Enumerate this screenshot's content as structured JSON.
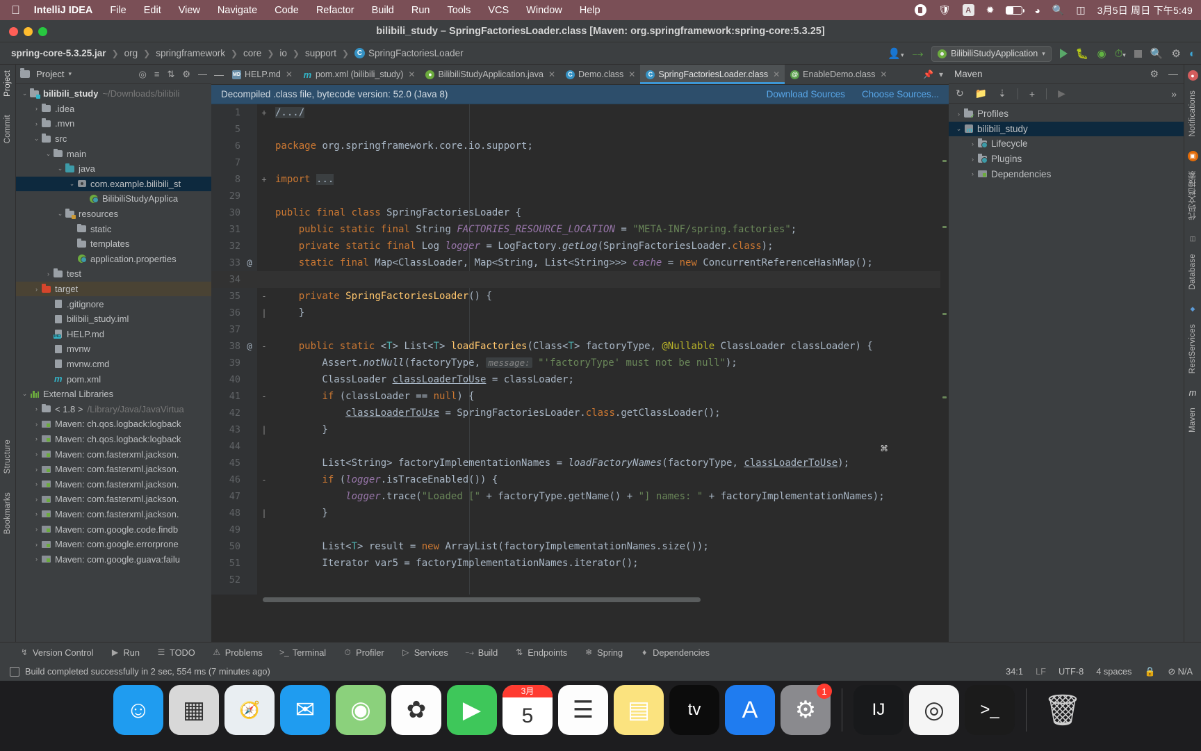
{
  "macos": {
    "apple_icon": "apple-icon",
    "app_name": "IntelliJ IDEA",
    "menus": [
      "File",
      "Edit",
      "View",
      "Navigate",
      "Code",
      "Refactor",
      "Build",
      "Run",
      "Tools",
      "VCS",
      "Window",
      "Help"
    ],
    "status_icons": [
      "record-icon",
      "shield-icon",
      "input-source-icon",
      "bluetooth-icon",
      "battery-icon",
      "wifi-icon",
      "search-icon",
      "control-center-icon"
    ],
    "input_source_label": "A",
    "clock": "3月5日 周日 下午5:49"
  },
  "window": {
    "title": "bilibili_study – SpringFactoriesLoader.class [Maven: org.springframework:spring-core:5.3.25]"
  },
  "breadcrumb": {
    "items": [
      "spring-core-5.3.25.jar",
      "org",
      "springframework",
      "core",
      "io",
      "support"
    ],
    "class_name": "SpringFactoriesLoader",
    "class_icon": "class-icon"
  },
  "toolbar": {
    "profile_icon": "user-profile-icon",
    "build_icon": "hammer-icon",
    "run_config": "BilibiliStudyApplication",
    "run_icon": "run-icon",
    "debug_icon": "debug-icon",
    "coverage_icon": "run-with-coverage-icon",
    "profiler_icon": "profiler-icon",
    "stop_icon": "stop-icon",
    "search_icon": "search-everywhere-icon",
    "settings_icon": "gear-icon",
    "updates_icon": "updates-icon"
  },
  "left_strip": {
    "items": [
      "Project",
      "Commit",
      "Structure",
      "Bookmarks"
    ]
  },
  "right_strip": {
    "items": [
      "Notifications",
      "代码文档搜索",
      "Database",
      "RestServices",
      "Maven"
    ]
  },
  "project_panel": {
    "title": "Project",
    "header_icons": [
      "locate-icon",
      "collapse-all-icon",
      "sort-icon",
      "settings-icon",
      "hide-icon"
    ],
    "tree": [
      {
        "indent": 0,
        "arrow": "v",
        "icon": "module-folder-icon",
        "label": "bilibili_study",
        "sub": "~/Downloads/bilibili",
        "bold": true,
        "state": "normal"
      },
      {
        "indent": 1,
        "arrow": ">",
        "icon": "folder-icon",
        "label": ".idea",
        "sub": "",
        "bold": false,
        "state": "normal"
      },
      {
        "indent": 1,
        "arrow": ">",
        "icon": "folder-icon",
        "label": ".mvn",
        "sub": "",
        "bold": false,
        "state": "normal"
      },
      {
        "indent": 1,
        "arrow": "v",
        "icon": "folder-icon",
        "label": "src",
        "sub": "",
        "bold": false,
        "state": "normal"
      },
      {
        "indent": 2,
        "arrow": "v",
        "icon": "folder-icon",
        "label": "main",
        "sub": "",
        "bold": false,
        "state": "normal"
      },
      {
        "indent": 3,
        "arrow": "v",
        "icon": "source-folder-icon",
        "label": "java",
        "sub": "",
        "bold": false,
        "state": "normal"
      },
      {
        "indent": 4,
        "arrow": "v",
        "icon": "package-icon",
        "label": "com.example.bilibili_st",
        "sub": "",
        "bold": false,
        "state": "selected"
      },
      {
        "indent": 5,
        "arrow": "",
        "icon": "spring-class-icon",
        "label": "BilibiliStudyApplica",
        "sub": "",
        "bold": false,
        "state": "normal"
      },
      {
        "indent": 3,
        "arrow": "v",
        "icon": "resource-folder-icon",
        "label": "resources",
        "sub": "",
        "bold": false,
        "state": "normal"
      },
      {
        "indent": 4,
        "arrow": "",
        "icon": "folder-icon",
        "label": "static",
        "sub": "",
        "bold": false,
        "state": "normal"
      },
      {
        "indent": 4,
        "arrow": "",
        "icon": "folder-icon",
        "label": "templates",
        "sub": "",
        "bold": false,
        "state": "normal"
      },
      {
        "indent": 4,
        "arrow": "",
        "icon": "spring-properties-icon",
        "label": "application.properties",
        "sub": "",
        "bold": false,
        "state": "normal"
      },
      {
        "indent": 2,
        "arrow": ">",
        "icon": "folder-icon",
        "label": "test",
        "sub": "",
        "bold": false,
        "state": "normal"
      },
      {
        "indent": 1,
        "arrow": ">",
        "icon": "excluded-folder-icon",
        "label": "target",
        "sub": "",
        "bold": false,
        "state": "highlighted"
      },
      {
        "indent": 2,
        "arrow": "",
        "icon": "gitignore-icon",
        "label": ".gitignore",
        "sub": "",
        "bold": false,
        "state": "normal"
      },
      {
        "indent": 2,
        "arrow": "",
        "icon": "iml-icon",
        "label": "bilibili_study.iml",
        "sub": "",
        "bold": false,
        "state": "normal"
      },
      {
        "indent": 2,
        "arrow": "",
        "icon": "markdown-icon",
        "label": "HELP.md",
        "sub": "",
        "bold": false,
        "state": "normal"
      },
      {
        "indent": 2,
        "arrow": "",
        "icon": "script-icon",
        "label": "mvnw",
        "sub": "",
        "bold": false,
        "state": "normal"
      },
      {
        "indent": 2,
        "arrow": "",
        "icon": "file-icon",
        "label": "mvnw.cmd",
        "sub": "",
        "bold": false,
        "state": "normal"
      },
      {
        "indent": 2,
        "arrow": "",
        "icon": "maven-icon",
        "label": "pom.xml",
        "sub": "",
        "bold": false,
        "state": "normal"
      },
      {
        "indent": 0,
        "arrow": "v",
        "icon": "libraries-icon",
        "label": "External Libraries",
        "sub": "",
        "bold": false,
        "state": "normal"
      },
      {
        "indent": 1,
        "arrow": ">",
        "icon": "jdk-icon",
        "label": "< 1.8 >",
        "sub": "/Library/Java/JavaVirtua",
        "bold": false,
        "state": "normal"
      },
      {
        "indent": 1,
        "arrow": ">",
        "icon": "library-jar-icon",
        "label": "Maven: ch.qos.logback:logback",
        "sub": "",
        "bold": false,
        "state": "normal"
      },
      {
        "indent": 1,
        "arrow": ">",
        "icon": "library-jar-icon",
        "label": "Maven: ch.qos.logback:logback",
        "sub": "",
        "bold": false,
        "state": "normal"
      },
      {
        "indent": 1,
        "arrow": ">",
        "icon": "library-jar-icon",
        "label": "Maven: com.fasterxml.jackson.",
        "sub": "",
        "bold": false,
        "state": "normal"
      },
      {
        "indent": 1,
        "arrow": ">",
        "icon": "library-jar-icon",
        "label": "Maven: com.fasterxml.jackson.",
        "sub": "",
        "bold": false,
        "state": "normal"
      },
      {
        "indent": 1,
        "arrow": ">",
        "icon": "library-jar-icon",
        "label": "Maven: com.fasterxml.jackson.",
        "sub": "",
        "bold": false,
        "state": "normal"
      },
      {
        "indent": 1,
        "arrow": ">",
        "icon": "library-jar-icon",
        "label": "Maven: com.fasterxml.jackson.",
        "sub": "",
        "bold": false,
        "state": "normal"
      },
      {
        "indent": 1,
        "arrow": ">",
        "icon": "library-jar-icon",
        "label": "Maven: com.fasterxml.jackson.",
        "sub": "",
        "bold": false,
        "state": "normal"
      },
      {
        "indent": 1,
        "arrow": ">",
        "icon": "library-jar-icon",
        "label": "Maven: com.google.code.findb",
        "sub": "",
        "bold": false,
        "state": "normal"
      },
      {
        "indent": 1,
        "arrow": ">",
        "icon": "library-jar-icon",
        "label": "Maven: com.google.errorprone",
        "sub": "",
        "bold": false,
        "state": "normal"
      },
      {
        "indent": 1,
        "arrow": ">",
        "icon": "library-jar-icon",
        "label": "Maven: com.google.guava:failu",
        "sub": "",
        "bold": false,
        "state": "normal"
      }
    ]
  },
  "editor": {
    "tabs": [
      {
        "label": "HELP.md",
        "icon": "markdown-icon",
        "active": false
      },
      {
        "label": "pom.xml (bilibili_study)",
        "icon": "maven-icon",
        "active": false
      },
      {
        "label": "BilibiliStudyApplication.java",
        "icon": "spring-class-icon",
        "active": false
      },
      {
        "label": "Demo.class",
        "icon": "class-icon",
        "active": false
      },
      {
        "label": "SpringFactoriesLoader.class",
        "icon": "class-icon",
        "active": true
      },
      {
        "label": "EnableDemo.class",
        "icon": "annotation-icon",
        "active": false
      }
    ],
    "banner": {
      "message": "Decompiled .class file, bytecode version: 52.0 (Java 8)",
      "download_sources": "Download Sources",
      "choose_sources": "Choose Sources..."
    },
    "code_lines": [
      {
        "num": "1",
        "at": "",
        "fold": "+",
        "current": false,
        "html": "<span class=\"chip\">/.../</span>"
      },
      {
        "num": "5",
        "at": "",
        "fold": "",
        "current": false,
        "html": ""
      },
      {
        "num": "6",
        "at": "",
        "fold": "",
        "current": false,
        "html": "<span class=\"kw\">package</span> org.springframework.core.io.support;"
      },
      {
        "num": "7",
        "at": "",
        "fold": "",
        "current": false,
        "html": ""
      },
      {
        "num": "8",
        "at": "",
        "fold": "+",
        "current": false,
        "html": "<span class=\"kw\">import</span> <span class=\"chip\">...</span>"
      },
      {
        "num": "29",
        "at": "",
        "fold": "",
        "current": false,
        "html": ""
      },
      {
        "num": "30",
        "at": "",
        "fold": "",
        "current": false,
        "html": "<span class=\"kw\">public final class</span> SpringFactoriesLoader {"
      },
      {
        "num": "31",
        "at": "",
        "fold": "",
        "current": false,
        "html": "    <span class=\"kw\">public static final</span> String <span class=\"fldi\">FACTORIES_RESOURCE_LOCATION</span> = <span class=\"str\">\"META-INF/spring.factories\"</span>;"
      },
      {
        "num": "32",
        "at": "",
        "fold": "",
        "current": false,
        "html": "    <span class=\"kw\">private static final</span> Log <span class=\"fldi\">logger</span> = LogFactory.<span class=\"stat\">getLog</span>(SpringFactoriesLoader.<span class=\"kw\">class</span>);"
      },
      {
        "num": "33",
        "at": "@",
        "fold": "",
        "current": false,
        "html": "    <span class=\"kw\">static final</span> Map&lt;ClassLoader, Map&lt;String, List&lt;String&gt;&gt;&gt; <span class=\"fldi\">cache</span> = <span class=\"kw\">new</span> ConcurrentReferenceHashMap();"
      },
      {
        "num": "34",
        "at": "",
        "fold": "",
        "current": true,
        "html": ""
      },
      {
        "num": "35",
        "at": "",
        "fold": "-",
        "current": false,
        "html": "    <span class=\"kw\">private</span> <span class=\"mth\">SpringFactoriesLoader</span>() {"
      },
      {
        "num": "36",
        "at": "",
        "fold": "|",
        "current": false,
        "html": "    }"
      },
      {
        "num": "37",
        "at": "",
        "fold": "",
        "current": false,
        "html": ""
      },
      {
        "num": "38",
        "at": "@",
        "fold": "-",
        "current": false,
        "html": "    <span class=\"kw\">public static</span> &lt;<span class=\"gen\">T</span>&gt; List&lt;<span class=\"gen\">T</span>&gt; <span class=\"mth\">loadFactories</span>(Class&lt;<span class=\"gen\">T</span>&gt; factoryType, <span class=\"ann2\">@Nullable</span> ClassLoader classLoader) {"
      },
      {
        "num": "39",
        "at": "",
        "fold": "",
        "current": false,
        "html": "        Assert.<span class=\"stat\">notNull</span>(factoryType, <span class=\"hint\">message:</span> <span class=\"str\">\"'factoryType' must not be null\"</span>);"
      },
      {
        "num": "40",
        "at": "",
        "fold": "",
        "current": false,
        "html": "        ClassLoader <span class=\"ul\">classLoaderToUse</span> = classLoader;"
      },
      {
        "num": "41",
        "at": "",
        "fold": "-",
        "current": false,
        "html": "        <span class=\"kw\">if</span> (classLoader == <span class=\"kw\">null</span>) {"
      },
      {
        "num": "42",
        "at": "",
        "fold": "",
        "current": false,
        "html": "            <span class=\"ul\">classLoaderToUse</span> = SpringFactoriesLoader.<span class=\"kw\">class</span>.getClassLoader();"
      },
      {
        "num": "43",
        "at": "",
        "fold": "|",
        "current": false,
        "html": "        }"
      },
      {
        "num": "44",
        "at": "",
        "fold": "",
        "current": false,
        "html": ""
      },
      {
        "num": "45",
        "at": "",
        "fold": "",
        "current": false,
        "html": "        List&lt;String&gt; factoryImplementationNames = <span class=\"stat\">loadFactoryNames</span>(factoryType, <span class=\"ul\">classLoaderToUse</span>);"
      },
      {
        "num": "46",
        "at": "",
        "fold": "-",
        "current": false,
        "html": "        <span class=\"kw\">if</span> (<span class=\"fldi\">logger</span>.isTraceEnabled()) {"
      },
      {
        "num": "47",
        "at": "",
        "fold": "",
        "current": false,
        "html": "            <span class=\"fldi\">logger</span>.trace(<span class=\"str\">\"Loaded [\"</span> + factoryType.getName() + <span class=\"str\">\"] names: \"</span> + factoryImplementationNames);"
      },
      {
        "num": "48",
        "at": "",
        "fold": "|",
        "current": false,
        "html": "        }"
      },
      {
        "num": "49",
        "at": "",
        "fold": "",
        "current": false,
        "html": ""
      },
      {
        "num": "50",
        "at": "",
        "fold": "",
        "current": false,
        "html": "        List&lt;<span class=\"gen\">T</span>&gt; result = <span class=\"kw\">new</span> ArrayList(factoryImplementationNames.size());"
      },
      {
        "num": "51",
        "at": "",
        "fold": "",
        "current": false,
        "html": "        Iterator var5 = factoryImplementationNames.iterator();"
      },
      {
        "num": "52",
        "at": "",
        "fold": "",
        "current": false,
        "html": ""
      }
    ]
  },
  "maven_panel": {
    "title": "Maven",
    "header_icons": [
      "gear-icon",
      "hide-icon"
    ],
    "toolbar_icons": [
      "reload-icon",
      "add-maven-project-icon",
      "download-sources-icon",
      "add-icon",
      "run-icon",
      "more-icon"
    ],
    "tree": [
      {
        "indent": 0,
        "arrow": ">",
        "icon": "profiles-icon",
        "label": "Profiles",
        "state": "normal"
      },
      {
        "indent": 0,
        "arrow": "v",
        "icon": "maven-project-icon",
        "label": "bilibili_study",
        "state": "selected"
      },
      {
        "indent": 1,
        "arrow": ">",
        "icon": "lifecycle-folder-icon",
        "label": "Lifecycle",
        "state": "normal"
      },
      {
        "indent": 1,
        "arrow": ">",
        "icon": "plugins-folder-icon",
        "label": "Plugins",
        "state": "normal"
      },
      {
        "indent": 1,
        "arrow": ">",
        "icon": "dependencies-icon",
        "label": "Dependencies",
        "state": "normal"
      }
    ]
  },
  "bottom_bar": {
    "items": [
      {
        "label": "Version Control",
        "icon": "branch-icon"
      },
      {
        "label": "Run",
        "icon": "run-icon"
      },
      {
        "label": "TODO",
        "icon": "todo-icon"
      },
      {
        "label": "Problems",
        "icon": "problems-icon"
      },
      {
        "label": "Terminal",
        "icon": "terminal-icon"
      },
      {
        "label": "Profiler",
        "icon": "profiler-icon"
      },
      {
        "label": "Services",
        "icon": "services-icon"
      },
      {
        "label": "Build",
        "icon": "hammer-icon"
      },
      {
        "label": "Endpoints",
        "icon": "endpoints-icon"
      },
      {
        "label": "Spring",
        "icon": "spring-icon"
      },
      {
        "label": "Dependencies",
        "icon": "dependencies-icon"
      }
    ]
  },
  "status_bar": {
    "message": "Build completed successfully in 2 sec, 554 ms (7 minutes ago)",
    "caret_position": "34:1",
    "line_separator": "LF",
    "encoding": "UTF-8",
    "indent": "4 spaces",
    "lock_icon": "lock-icon",
    "inspection": "⊘ N/A"
  },
  "dock": {
    "icons": [
      {
        "name": "finder-icon",
        "glyph": "☺",
        "bg": "#1f9cf0",
        "badge": ""
      },
      {
        "name": "launchpad-icon",
        "glyph": "▦",
        "bg": "#d8d8d8",
        "badge": ""
      },
      {
        "name": "safari-icon",
        "glyph": "🧭",
        "bg": "#e9eef2",
        "badge": ""
      },
      {
        "name": "mail-icon",
        "glyph": "✉",
        "bg": "#1f9cf0",
        "badge": ""
      },
      {
        "name": "maps-icon",
        "glyph": "◉",
        "bg": "#8bd17c",
        "badge": ""
      },
      {
        "name": "photos-icon",
        "glyph": "✿",
        "bg": "#fdfdfd",
        "badge": ""
      },
      {
        "name": "facetime-icon",
        "glyph": "▶",
        "bg": "#3ec75a",
        "badge": ""
      },
      {
        "name": "calendar-icon",
        "glyph": "5",
        "bg": "#ffffff",
        "badge": ""
      },
      {
        "name": "reminders-icon",
        "glyph": "☰",
        "bg": "#fdfdfd",
        "badge": ""
      },
      {
        "name": "notes-icon",
        "glyph": "▤",
        "bg": "#fbe37f",
        "badge": ""
      },
      {
        "name": "appletv-icon",
        "glyph": "tv",
        "bg": "#0c0c0c",
        "badge": ""
      },
      {
        "name": "appstore-icon",
        "glyph": "A",
        "bg": "#1f7cf0",
        "badge": ""
      },
      {
        "name": "settings-icon",
        "glyph": "⚙",
        "bg": "#8a8a8e",
        "badge": "1"
      },
      {
        "name": "intellij-idea-icon",
        "glyph": "IJ",
        "bg": "#18191b",
        "badge": ""
      },
      {
        "name": "chrome-icon",
        "glyph": "◎",
        "bg": "#f5f5f5",
        "badge": ""
      },
      {
        "name": "terminal-icon",
        "glyph": ">_",
        "bg": "#1b1b1b",
        "badge": ""
      }
    ],
    "trash": {
      "name": "trash-icon",
      "glyph": "🗑"
    },
    "calendar_month": "3月",
    "calendar_day": "5"
  }
}
